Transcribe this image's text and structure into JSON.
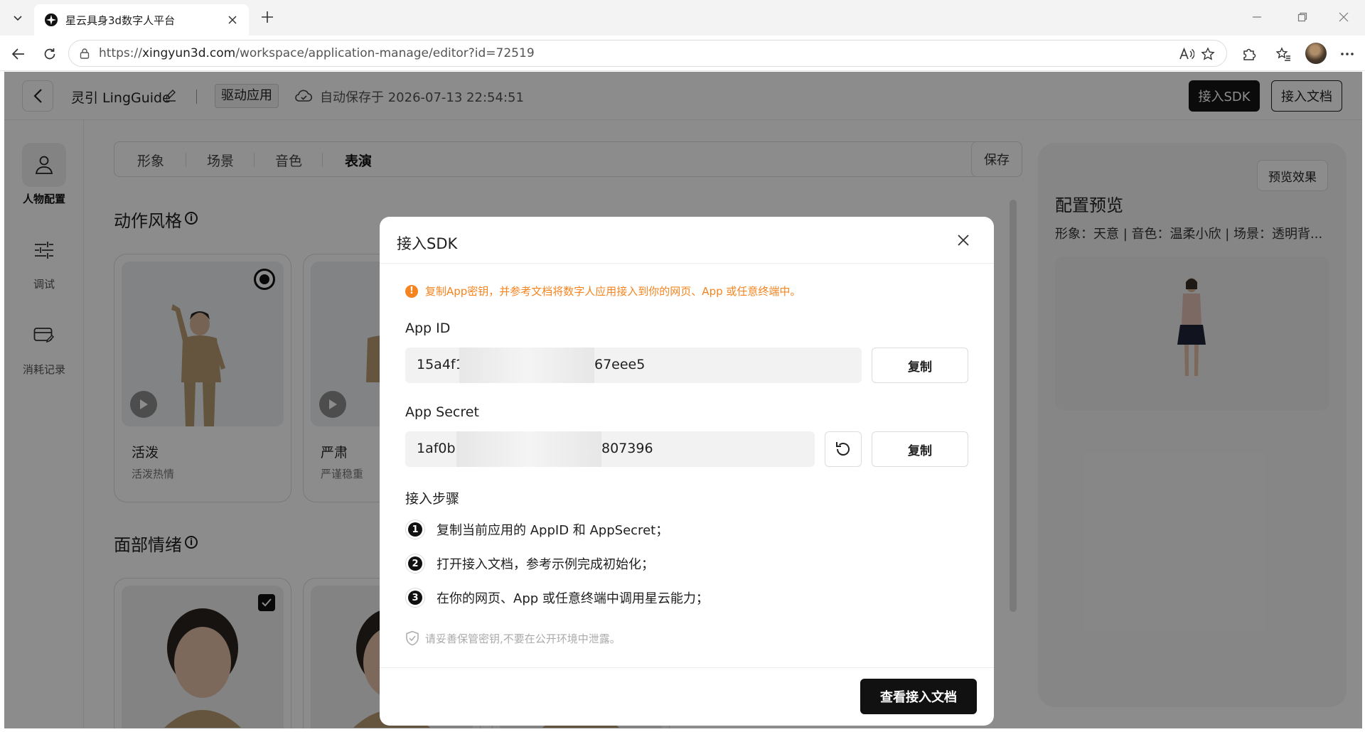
{
  "browser": {
    "tab_title": "星云具身3d数字人平台",
    "url_prefix": "https://",
    "url_host": "xingyun3d.com",
    "url_path": "/workspace/application-manage/editor?id=72519"
  },
  "header": {
    "app_name": "灵引 LingGuide",
    "app_type": "驱动应用",
    "autosave": "自动保存于 2026-07-13 22:54:51",
    "sdk_button": "接入SDK",
    "doc_button": "接入文档"
  },
  "sidebar": {
    "items": [
      {
        "label": "人物配置",
        "icon": "person-icon",
        "active": true
      },
      {
        "label": "调试",
        "icon": "sliders-icon",
        "active": false
      },
      {
        "label": "消耗记录",
        "icon": "card-edit-icon",
        "active": false
      }
    ]
  },
  "config_tabs": {
    "items": [
      "形象",
      "场景",
      "音色",
      "表演"
    ],
    "active": "表演",
    "save_partial": "保存"
  },
  "sections": {
    "action_style": "动作风格",
    "face_emotion": "面部情绪"
  },
  "action_cards": [
    {
      "title": "活泼",
      "subtitle": "活泼热情",
      "selected": true
    },
    {
      "title": "严肃",
      "subtitle": "严谨稳重",
      "selected": false
    }
  ],
  "preview": {
    "button": "预览效果",
    "title": "配置预览",
    "description": "形象：天意 | 音色：温柔小欣 | 场景：透明背..."
  },
  "modal": {
    "title": "接入SDK",
    "warning": "复制App密钥，并参考文档将数字人应用接入到你的网页、App 或任意终端中。",
    "app_id_label": "App ID",
    "app_id_start": "15a4f12",
    "app_id_end": "67eee5",
    "app_secret_label": "App Secret",
    "app_secret_start": "1af0b6",
    "app_secret_end": "807396",
    "copy_label": "复制",
    "steps_title": "接入步骤",
    "steps": [
      {
        "num": "1",
        "text": "复制当前应用的 AppID 和 AppSecret；"
      },
      {
        "num": "2",
        "text": "打开接入文档，参考示例完成初始化；"
      },
      {
        "num": "3",
        "text": "在你的网页、App 或任意终端中调用星云能力；"
      }
    ],
    "safety_note": "请妥善保管密钥,不要在公开环境中泄露。",
    "doc_button": "查看接入文档"
  },
  "colors": {
    "warning": "#f5841f",
    "primary": "#111111",
    "overlay": "rgba(0,0,0,0.45)"
  }
}
